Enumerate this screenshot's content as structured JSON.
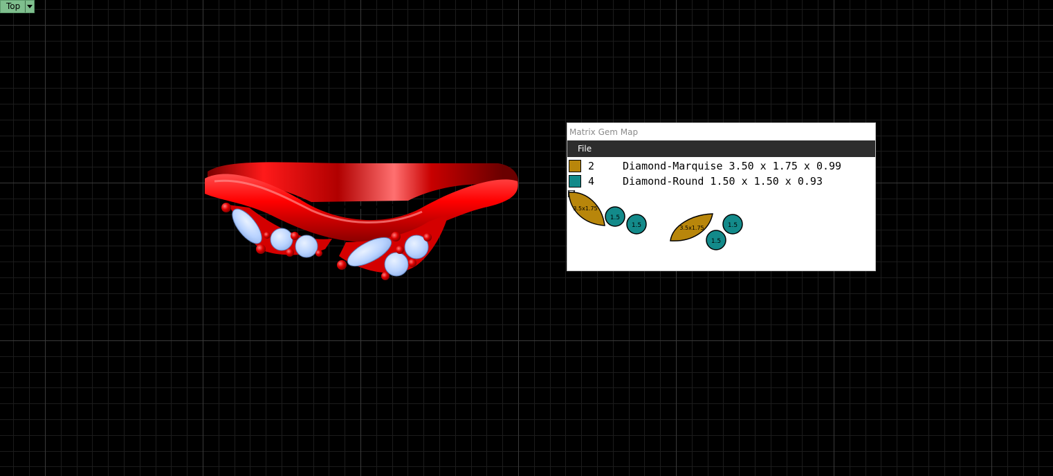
{
  "viewport": {
    "label": "Top",
    "dropdown_icon": "dropdown-arrow-icon"
  },
  "gem_map": {
    "title": "Matrix Gem Map",
    "menu_file": "File",
    "rows": [
      {
        "color": "#b8860b",
        "count": "2",
        "description": "Diamond-Marquise 3.50 x 1.75 x 0.99"
      },
      {
        "color": "#138a8a",
        "count": "4",
        "description": "Diamond-Round 1.50 x 1.50 x 0.93"
      }
    ],
    "marquise_label": "3.5x1.75",
    "round_label": "1.5"
  },
  "colors": {
    "metal": "#ff0000",
    "diamond": "#bcd6ff",
    "marquise_swatch": "#b8860b",
    "round_swatch": "#138a8a"
  }
}
